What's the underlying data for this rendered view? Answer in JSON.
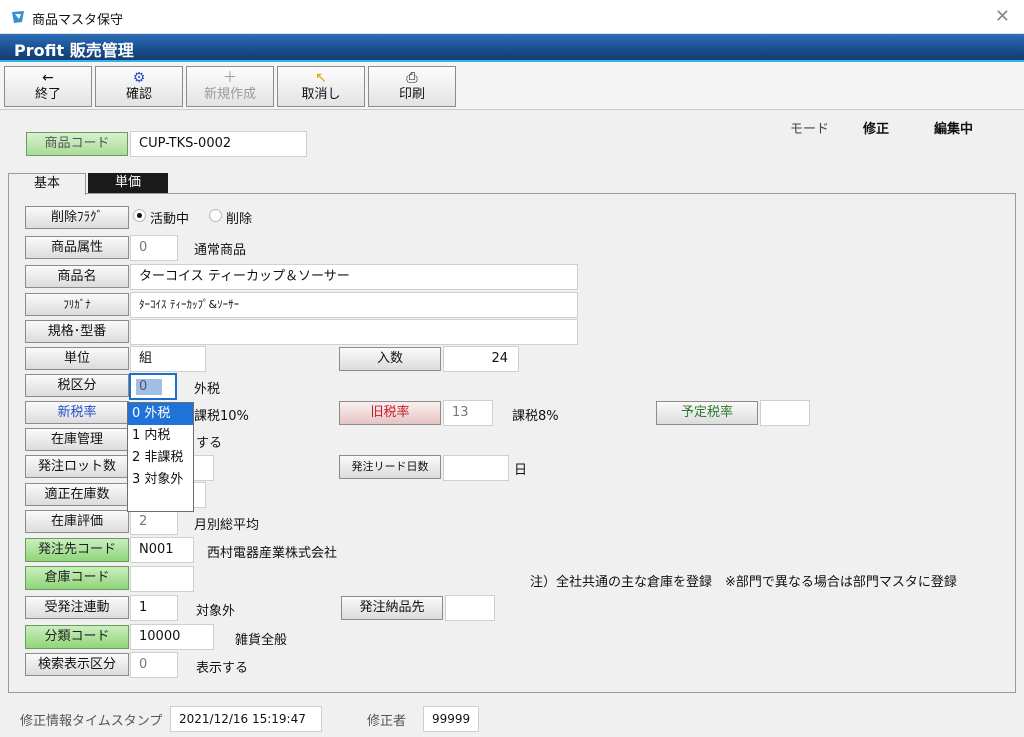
{
  "window": {
    "title": "商品マスタ保守",
    "close_glyph": "✕"
  },
  "banner": {
    "brand": "Profit 販売管理"
  },
  "toolbar": {
    "buttons": [
      {
        "icon": "←",
        "label": "終了"
      },
      {
        "icon": "⚙",
        "label": "確認"
      },
      {
        "icon": "＋",
        "label": "新規作成"
      },
      {
        "icon": "↖",
        "label": "取消し"
      },
      {
        "icon": "⎙",
        "label": "印刷"
      }
    ]
  },
  "mode": {
    "label": "モード",
    "value": "修正",
    "state": "編集中"
  },
  "product_code": {
    "label": "商品コード",
    "value": "CUP-TKS-0002"
  },
  "tabs": [
    "基本",
    "単価"
  ],
  "form": {
    "delete_flag": {
      "label": "削除ﾌﾗｸﾞ",
      "opt_active": "活動中",
      "opt_deleted": "削除"
    },
    "attribute": {
      "label": "商品属性",
      "value": "0",
      "text": "通常商品"
    },
    "name": {
      "label": "商品名",
      "value": "ターコイス ティーカップ＆ソーサー"
    },
    "furigana": {
      "label": "ﾌﾘｶﾞﾅ",
      "value": "ﾀｰｺｲｽ ﾃｨｰｶｯﾌﾟ&ｿｰｻｰ"
    },
    "spec": {
      "label": "規格･型番",
      "value": ""
    },
    "unit": {
      "label": "単位",
      "value": "組"
    },
    "quantity": {
      "label": "入数",
      "value": "24"
    },
    "tax_class": {
      "label": "税区分",
      "value": "0",
      "text": "外税"
    },
    "new_rate": {
      "label": "新税率",
      "text": "課税10%"
    },
    "old_rate": {
      "label": "旧税率",
      "value": "13",
      "text": "課税8%"
    },
    "planned_rate": {
      "label": "予定税率",
      "value": ""
    },
    "stock_mgmt": {
      "label": "在庫管理",
      "text": "する"
    },
    "order_lot": {
      "label": "発注ロット数"
    },
    "lead_days": {
      "label": "発注リード日数",
      "value": "",
      "unit": "日"
    },
    "proper_stock": {
      "label": "適正在庫数"
    },
    "valuation": {
      "label": "在庫評価",
      "value": "2",
      "text": "月別総平均"
    },
    "supplier": {
      "label": "発注先コード",
      "value": "N001",
      "text": "西村電器産業株式会社"
    },
    "warehouse": {
      "label": "倉庫コード",
      "value": "",
      "note": "注）全社共通の主な倉庫を登録　※部門で異なる場合は部門マスタに登録"
    },
    "order_link": {
      "label": "受発注連動",
      "value": "1",
      "text": "対象外"
    },
    "delivery": {
      "label": "発注納品先",
      "value": ""
    },
    "category": {
      "label": "分類コード",
      "value": "10000",
      "text": "雑貨全般"
    },
    "search_disp": {
      "label": "検索表示区分",
      "value": "0",
      "text": "表示する"
    }
  },
  "dropdown": {
    "options": [
      "0 外税",
      "1 内税",
      "2 非課税",
      "3 対象外"
    ]
  },
  "status": {
    "ts_label": "修正情報タイムスタンプ",
    "ts_value": "2021/12/16 15:19:47",
    "user_label": "修正者",
    "user_value": "99999"
  }
}
